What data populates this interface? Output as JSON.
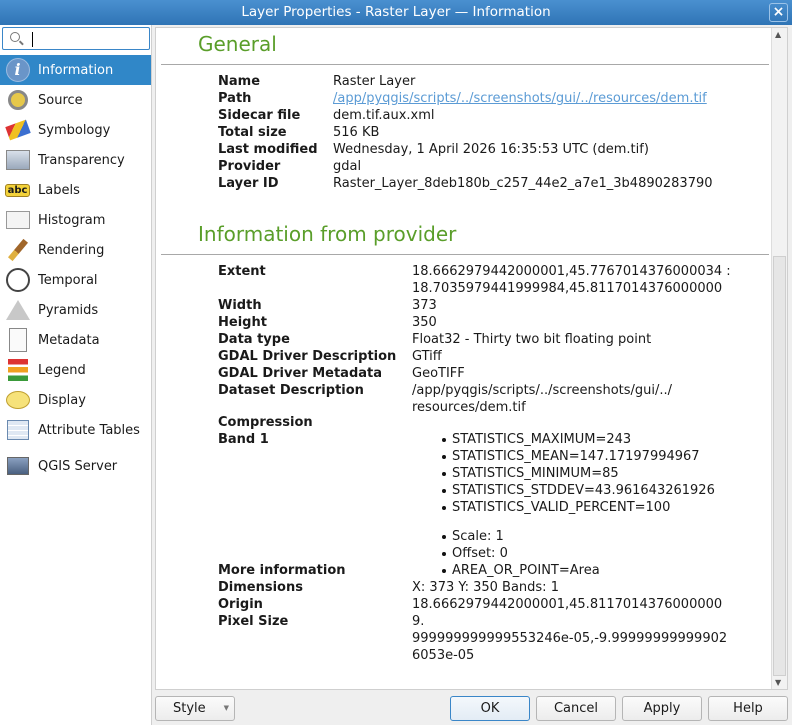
{
  "window": {
    "title": "Layer Properties - Raster Layer — Information",
    "close": "×"
  },
  "search": {
    "placeholder": ""
  },
  "sidebar": {
    "items": [
      {
        "label": "Information",
        "icon": "info-icon"
      },
      {
        "label": "Source",
        "icon": "source-icon"
      },
      {
        "label": "Symbology",
        "icon": "symbology-icon"
      },
      {
        "label": "Transparency",
        "icon": "transparency-icon"
      },
      {
        "label": "Labels",
        "icon": "labels-icon"
      },
      {
        "label": "Histogram",
        "icon": "histogram-icon"
      },
      {
        "label": "Rendering",
        "icon": "rendering-icon"
      },
      {
        "label": "Temporal",
        "icon": "clock-icon"
      },
      {
        "label": "Pyramids",
        "icon": "pyramids-icon"
      },
      {
        "label": "Metadata",
        "icon": "metadata-icon"
      },
      {
        "label": "Legend",
        "icon": "legend-icon"
      },
      {
        "label": "Display",
        "icon": "display-icon"
      },
      {
        "label": "Attribute Tables",
        "icon": "table-icon"
      },
      {
        "label": "QGIS Server",
        "icon": "server-icon"
      }
    ],
    "labels_abc": "abc"
  },
  "general": {
    "heading": "General",
    "rows": [
      {
        "label": "Name",
        "value": "Raster Layer"
      },
      {
        "label": "Path",
        "value": "/app/pyqgis/scripts/../screenshots/gui/../resources/dem.tif"
      },
      {
        "label": "Sidecar file",
        "value": "dem.tif.aux.xml"
      },
      {
        "label": "Total size",
        "value": "516 KB"
      },
      {
        "label": "Last modified",
        "value": "Wednesday, 1 April 2026 16:35:53 UTC (dem.tif)"
      },
      {
        "label": "Provider",
        "value": "gdal"
      },
      {
        "label": "Layer ID",
        "value": "Raster_Layer_8deb180b_c257_44e2_a7e1_3b4890283790"
      }
    ]
  },
  "provider": {
    "heading": "Information from provider",
    "extent": {
      "label": "Extent",
      "line1": "18.6662979442000001,45.7767014376000034 :",
      "line2": "18.7035979441999984,45.8117014376000000"
    },
    "rows": [
      {
        "label": "Width",
        "value": "373"
      },
      {
        "label": "Height",
        "value": "350"
      },
      {
        "label": "Data type",
        "value": "Float32 - Thirty two bit floating point"
      },
      {
        "label": "GDAL Driver Description",
        "value": "GTiff"
      },
      {
        "label": "GDAL Driver Metadata",
        "value": "GeoTIFF"
      }
    ],
    "dataset": {
      "label": "Dataset Description",
      "line1": "/app/pyqgis/scripts/../screenshots/gui/../",
      "line2": "resources/dem.tif"
    },
    "compression": {
      "label": "Compression",
      "value": ""
    },
    "band": {
      "label": "Band 1",
      "stats": [
        "STATISTICS_MAXIMUM=243",
        "STATISTICS_MEAN=147.17197994967",
        "STATISTICS_MINIMUM=85",
        "STATISTICS_STDDEV=43.961643261926",
        "STATISTICS_VALID_PERCENT=100"
      ],
      "extra": [
        "Scale: 1",
        "Offset: 0",
        "AREA_OR_POINT=Area"
      ]
    },
    "more_info": {
      "label": "More information"
    },
    "rows2": [
      {
        "label": "Dimensions",
        "value": "X: 373 Y: 350 Bands: 1"
      },
      {
        "label": "Origin",
        "value": "18.6662979442000001,45.8117014376000000"
      }
    ],
    "pixel": {
      "label": "Pixel Size",
      "line1": "9.",
      "line2": "999999999999553246e-05,-9.99999999999902",
      "line3": "6053e-05"
    }
  },
  "buttons": {
    "style": "Style",
    "ok": "OK",
    "cancel": "Cancel",
    "apply": "Apply",
    "help": "Help"
  },
  "colors": {
    "accent": "#3087c8",
    "heading": "#5a9e2a",
    "link": "#5b9bd5"
  }
}
